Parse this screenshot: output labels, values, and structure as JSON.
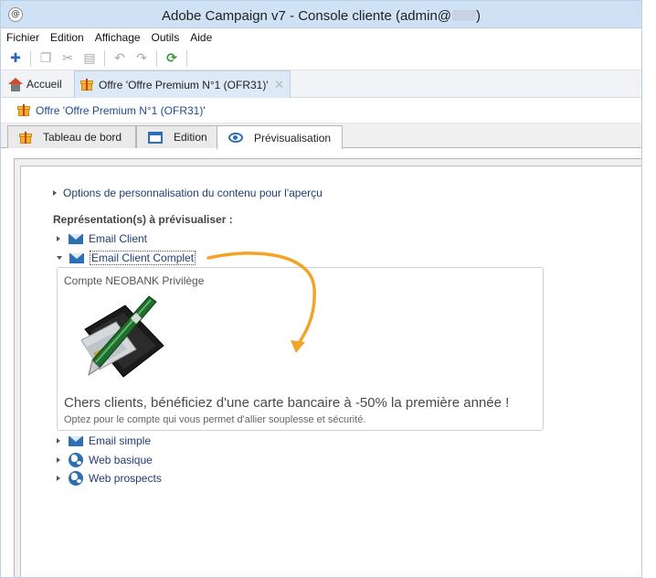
{
  "window": {
    "title": "Adobe Campaign v7 - Console cliente (admin@",
    "title_suffix": ")"
  },
  "menu": [
    "Fichier",
    "Edition",
    "Affichage",
    "Outils",
    "Aide"
  ],
  "toolbar": {
    "icons": [
      "add-user-icon",
      "copy-icon",
      "cut-icon",
      "paste-icon",
      "undo-icon",
      "redo-icon",
      "refresh-icon"
    ]
  },
  "doc_tabs": {
    "home_label": "Accueil",
    "offer_label": "Offre 'Offre Premium N°1 (OFR31)'"
  },
  "record": {
    "title": "Offre 'Offre Premium N°1 (OFR31)'"
  },
  "inner_tabs": [
    "Tableau de bord",
    "Edition",
    "Prévisualisation"
  ],
  "preview": {
    "options_link": "Options de personnalisation du contenu pour l'aperçu",
    "section_label": "Représentation(s) à prévisualiser :",
    "representations": [
      {
        "label": "Email Client",
        "icon": "mail-icon",
        "expanded": false
      },
      {
        "label": "Email Client Complet",
        "icon": "mail-icon",
        "expanded": true
      },
      {
        "label": "Email simple",
        "icon": "mail-icon",
        "expanded": false
      },
      {
        "label": "Web basique",
        "icon": "globe-icon",
        "expanded": false
      },
      {
        "label": "Web prospects",
        "icon": "globe-icon",
        "expanded": false
      }
    ],
    "card": {
      "title": "Compte NEOBANK Privilège",
      "headline": "Chers clients, bénéficiez d'une carte bancaire à -50% la première année !",
      "subtext": "Optez pour le compte qui vous permet d'allier souplesse et sécurité."
    }
  },
  "colors": {
    "link": "#1f3d73",
    "accent": "#2d6fb3",
    "annotation_arrow": "#f0a528"
  }
}
